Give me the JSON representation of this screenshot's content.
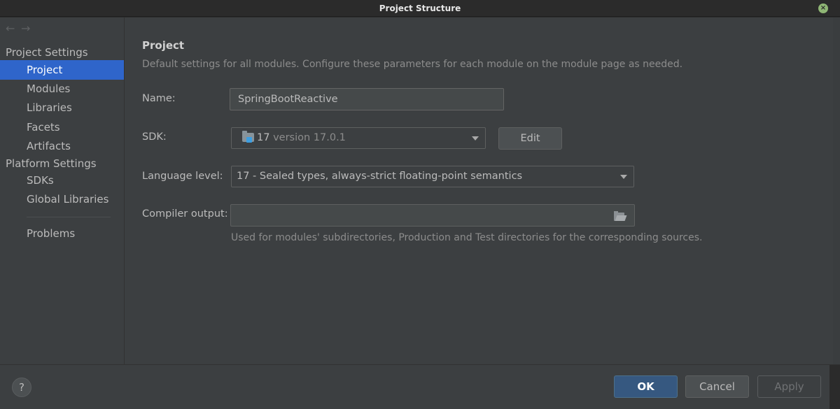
{
  "window": {
    "title": "Project Structure"
  },
  "sidebar": {
    "project_settings_title": "Project Settings",
    "project_items": [
      {
        "label": "Project",
        "selected": true
      },
      {
        "label": "Modules"
      },
      {
        "label": "Libraries"
      },
      {
        "label": "Facets"
      },
      {
        "label": "Artifacts"
      }
    ],
    "platform_settings_title": "Platform Settings",
    "platform_items": [
      {
        "label": "SDKs"
      },
      {
        "label": "Global Libraries"
      }
    ],
    "problems_label": "Problems"
  },
  "main": {
    "heading": "Project",
    "description": "Default settings for all modules. Configure these parameters for each module on the module page as needed.",
    "name": {
      "label": "Name:",
      "value": "SpringBootReactive"
    },
    "sdk": {
      "label": "SDK:",
      "name": "17",
      "version": "version 17.0.1",
      "edit_label": "Edit"
    },
    "language_level": {
      "label": "Language level:",
      "value": "17 - Sealed types, always-strict floating-point semantics"
    },
    "compiler_output": {
      "label": "Compiler output:",
      "value": "",
      "hint": "Used for modules' subdirectories, Production and Test directories for the corresponding sources."
    }
  },
  "footer": {
    "help_label": "?",
    "ok_label": "OK",
    "cancel_label": "Cancel",
    "apply_label": "Apply"
  },
  "colors": {
    "selection": "#2f65ca",
    "panel": "#3c3f41",
    "ok_button": "#365880"
  }
}
